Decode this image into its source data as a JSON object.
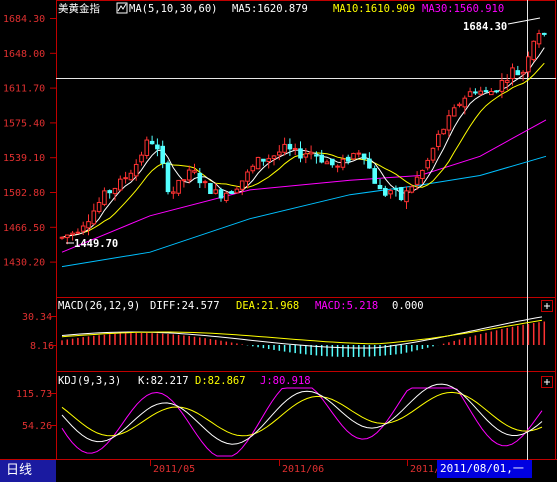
{
  "main_panel": {
    "title": "美黄金指",
    "ma_header": "MA(5,10,30,60)",
    "ma5": "MA5:1620.879",
    "ma10": "MA10:1610.909",
    "ma30": "MA30:1560.910",
    "y_ticks": [
      "1684.30",
      "1648.00",
      "1611.70",
      "1575.40",
      "1539.10",
      "1502.80",
      "1466.50",
      "1430.20"
    ],
    "high_label": "1684.30",
    "low_label": "1449.70"
  },
  "macd_panel": {
    "header": "MACD(26,12,9)",
    "diff": "DIFF:24.577",
    "dea": "DEA:21.968",
    "macd": "MACD:5.218",
    "extra": "0.000",
    "y_ticks": [
      "30.34",
      "8.16"
    ]
  },
  "kdj_panel": {
    "header": "KDJ(9,3,3)",
    "k": "K:82.217",
    "d": "D:82.867",
    "j": "J:80.918",
    "y_ticks": [
      "115.73",
      "54.26"
    ]
  },
  "x_axis": {
    "labels": [
      "2011/05",
      "2011/06",
      "2011/"
    ]
  },
  "bottom": {
    "period_tab": "日线",
    "cursor_date": "2011/08/01,一"
  },
  "colors": {
    "up": "#ff3232",
    "down": "#54ffff",
    "ma5": "#ffffff",
    "ma10": "#ffff00",
    "ma30": "#ff00ff",
    "ma60": "#00c0ff",
    "axis": "#c00000"
  },
  "chart_data": {
    "type": "candlestick",
    "ylim": [
      1430.2,
      1684.3
    ],
    "high": 1684.3,
    "low": 1449.7
  }
}
